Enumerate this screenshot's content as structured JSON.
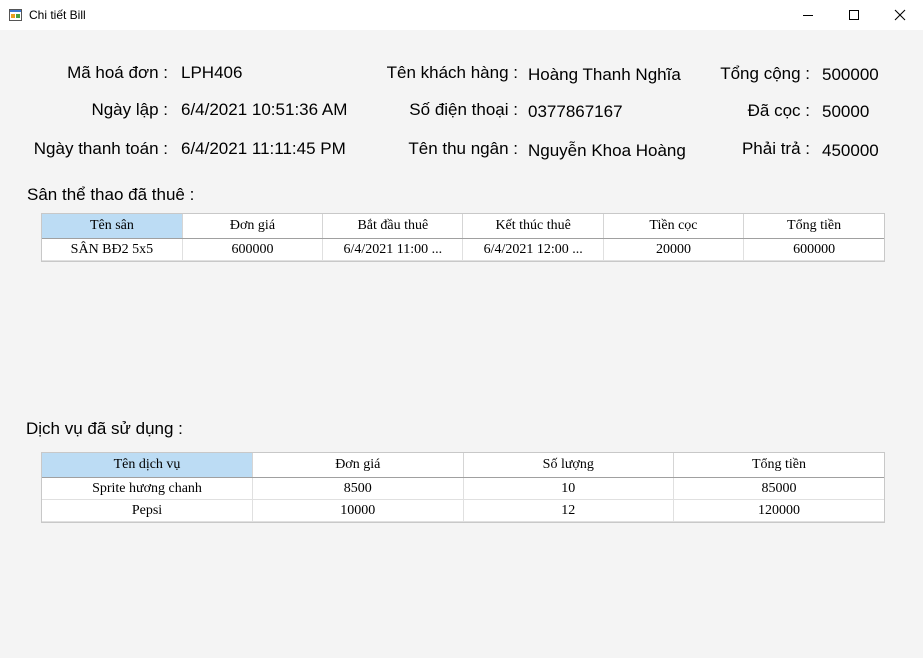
{
  "window": {
    "title": "Chi tiết Bill",
    "icon": "app-form-icon",
    "controls": [
      "minimize-icon",
      "maximize-icon",
      "close-icon"
    ]
  },
  "bill": {
    "ma_hoa_don_label": "Mã hoá đơn :",
    "ma_hoa_don": "LPH406",
    "ngay_lap_label": "Ngày lập :",
    "ngay_lap": "6/4/2021 10:51:36 AM",
    "ngay_thanh_toan_label": "Ngày thanh toán :",
    "ngay_thanh_toan": "6/4/2021 11:11:45 PM",
    "ten_khach_hang_label": "Tên khách hàng :",
    "ten_khach_hang": "Hoàng Thanh Nghĩa",
    "so_dien_thoai_label": "Số điện thoại :",
    "so_dien_thoai": "0377867167",
    "ten_thu_ngan_label": "Tên thu ngân :",
    "ten_thu_ngan": "Nguyễn Khoa Hoàng",
    "tong_cong_label": "Tổng cộng :",
    "tong_cong": "500000",
    "da_coc_label": "Đã cọc :",
    "da_coc": "50000",
    "phai_tra_label": "Phải trả :",
    "phai_tra": "450000"
  },
  "san_section": {
    "title": "Sân thể thao đã thuê :",
    "columns": [
      "Tên sân",
      "Đơn giá",
      "Bắt đầu thuê",
      "Kết thúc thuê",
      "Tiền cọc",
      "Tổng tiền"
    ],
    "rows": [
      [
        "SÂN BĐ2 5x5",
        "600000",
        "6/4/2021 11:00 ...",
        "6/4/2021 12:00 ...",
        "20000",
        "600000"
      ]
    ]
  },
  "dich_vu_section": {
    "title": "Dịch vụ đã sử dụng :",
    "columns": [
      "Tên dịch vụ",
      "Đơn giá",
      "Số lượng",
      "Tổng tiền"
    ],
    "rows": [
      [
        "Sprite hương chanh",
        "8500",
        "10",
        "85000"
      ],
      [
        "Pepsi",
        "10000",
        "12",
        "120000"
      ]
    ]
  },
  "colors": {
    "selected_header": "#bcdcf4",
    "client_background": "#f4f4f4",
    "titlebar": "#ffffff"
  }
}
